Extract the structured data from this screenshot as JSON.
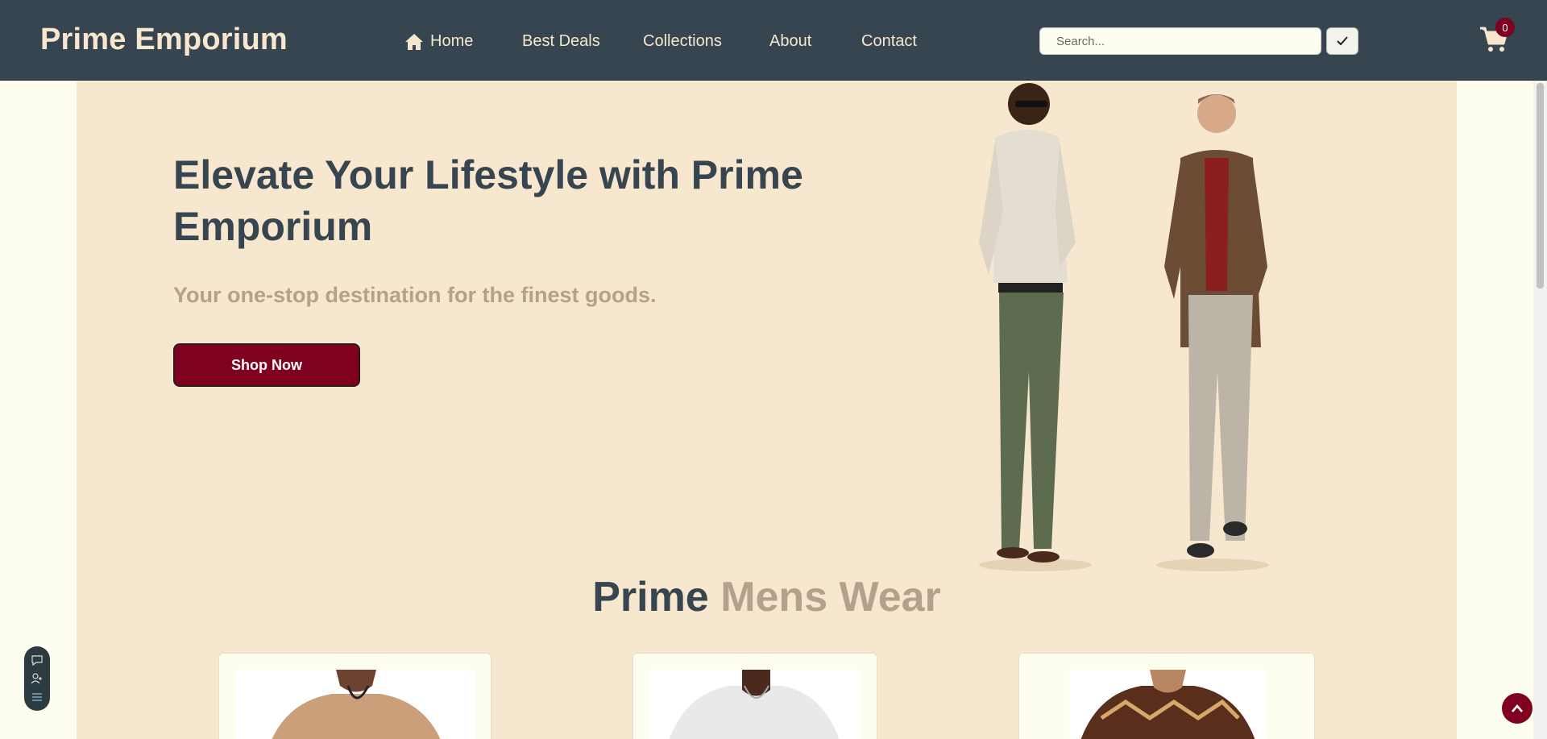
{
  "brand": "Prime Emporium",
  "nav": {
    "home": "Home",
    "best_deals": "Best Deals",
    "collections": "Collections",
    "about": "About",
    "contact": "Contact"
  },
  "search": {
    "placeholder": "Search..."
  },
  "cart": {
    "count": "0"
  },
  "hero": {
    "title": "Elevate Your Lifestyle with Prime Emporium",
    "subtitle": "Your one-stop destination for the finest goods.",
    "cta": "Shop Now"
  },
  "section": {
    "title_part1": "Prime",
    "title_part2": "Mens Wear"
  },
  "colors": {
    "navbar": "#36454f",
    "cream": "#f7e7ce",
    "accent": "#800020",
    "muted": "#b4a18c"
  },
  "icons": {
    "home": "home-icon",
    "search_submit": "check-icon",
    "cart": "cart-icon",
    "scroll_top": "chevron-up-icon"
  }
}
